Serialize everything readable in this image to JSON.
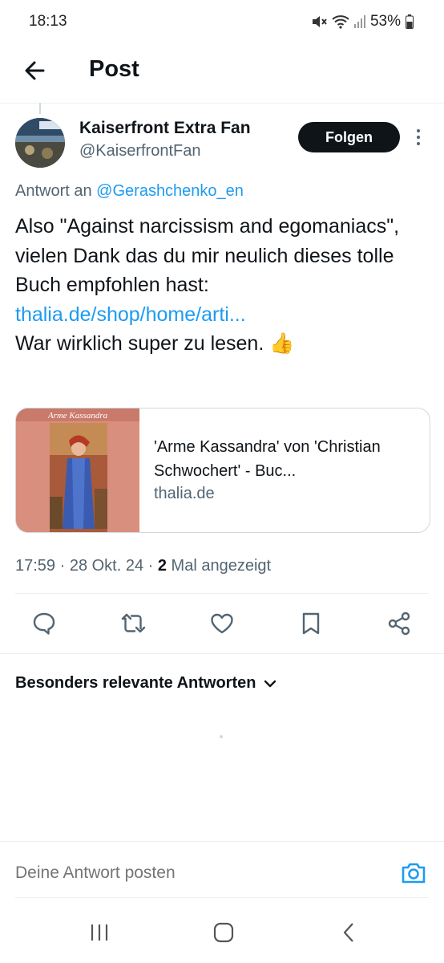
{
  "status": {
    "time": "18:13",
    "battery": "53%"
  },
  "header": {
    "title": "Post"
  },
  "post": {
    "author_name": "Kaiserfront Extra Fan",
    "author_handle": "@KaiserfrontFan",
    "follow_label": "Folgen",
    "reply_prefix": "Antwort an ",
    "reply_mention": "@Gerashchenko_en",
    "text_before_link": "Also \"Against narcissism and egomaniacs\", vielen Dank das du mir neulich dieses tolle Buch empfohlen hast:",
    "link": "thalia.de/shop/home/arti...",
    "text_after_link": "War wirklich super zu lesen. 👍",
    "card": {
      "image_caption": "Arme Kassandra",
      "title": "'Arme Kassandra' von 'Christian Schwochert' - Buc...",
      "domain": "thalia.de"
    },
    "meta_time": "17:59 · 28 Okt. 24 · ",
    "view_count": "2",
    "view_label": " Mal angezeigt"
  },
  "actions": [
    {
      "name": "reply-icon"
    },
    {
      "name": "repost-icon"
    },
    {
      "name": "like-icon"
    },
    {
      "name": "bookmark-icon"
    },
    {
      "name": "share-icon"
    }
  ],
  "replies": {
    "sort_label": "Besonders relevante Antworten"
  },
  "compose": {
    "placeholder": "Deine Antwort posten"
  },
  "colors": {
    "accent": "#1d9bf0",
    "text": "#0f1419",
    "muted": "#536471"
  }
}
